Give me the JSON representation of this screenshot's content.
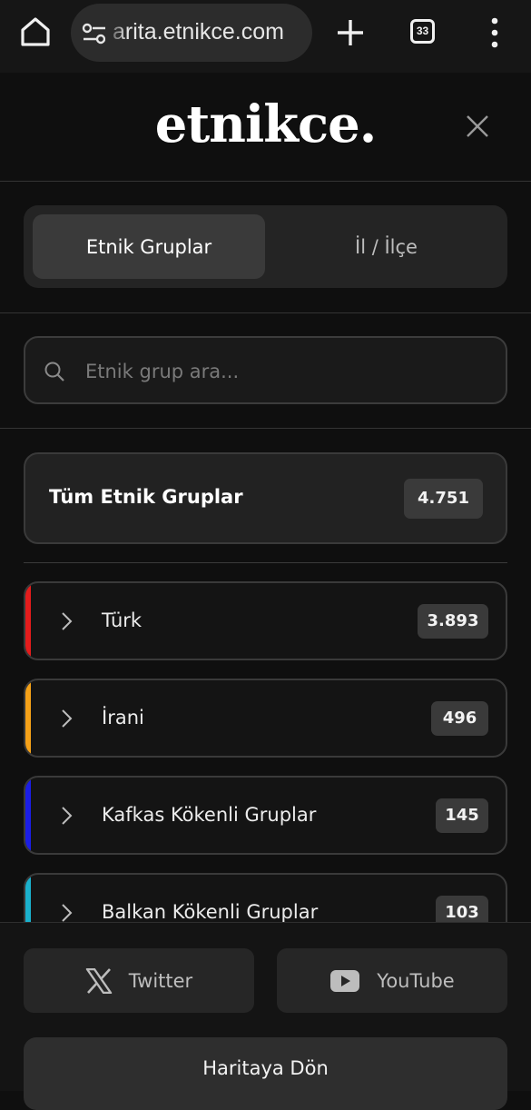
{
  "browser": {
    "url": "arita.etnikce.com",
    "tab_count": "33"
  },
  "header": {
    "logo": "etnikce."
  },
  "tabs": [
    {
      "label": "Etnik Gruplar",
      "active": true
    },
    {
      "label": "İl / İlçe",
      "active": false
    }
  ],
  "search": {
    "placeholder": "Etnik grup ara..."
  },
  "all_groups": {
    "label": "Tüm Etnik Gruplar",
    "count": "4.751"
  },
  "groups": [
    {
      "name": "Türk",
      "count": "3.893",
      "color": "#e41c1c"
    },
    {
      "name": "İrani",
      "count": "496",
      "color": "#f5a118"
    },
    {
      "name": "Kafkas Kökenli Gruplar",
      "count": "145",
      "color": "#1b1ee6"
    },
    {
      "name": "Balkan Kökenli Gruplar",
      "count": "103",
      "color": "#1ab0cc"
    }
  ],
  "footer": {
    "twitter_label": "Twitter",
    "youtube_label": "YouTube",
    "map_button": "Haritaya Dön"
  }
}
